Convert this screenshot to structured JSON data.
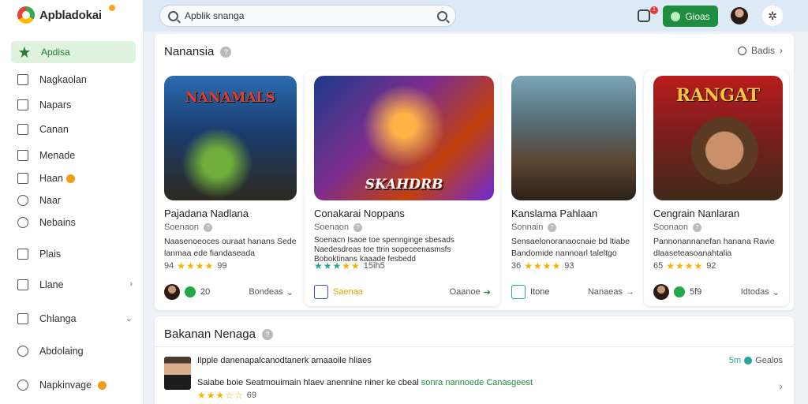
{
  "app": {
    "name": "Apbladokai"
  },
  "sidebar": {
    "active": {
      "label": "Apdisa",
      "icon": "star-icon"
    },
    "items": [
      {
        "label": "Nagkaolan",
        "icon": "list-icon"
      },
      {
        "label": "Napars",
        "icon": "document-icon"
      },
      {
        "label": "Canan",
        "icon": "message-icon"
      },
      {
        "label": "Menade",
        "icon": "mail-icon"
      },
      {
        "label": "Haan",
        "icon": "folder-icon"
      },
      {
        "label": "Naar",
        "icon": "music-icon"
      },
      {
        "label": "Nebains",
        "icon": "globe-icon"
      },
      {
        "label": "Plais",
        "icon": "grid-icon"
      },
      {
        "label": "Llane",
        "icon": "download-icon"
      },
      {
        "label": "Chlanga",
        "icon": "edit-icon"
      },
      {
        "label": "Abdolaing",
        "icon": "info-icon"
      },
      {
        "label": "Napkinvage",
        "icon": "settings-icon"
      }
    ]
  },
  "topbar": {
    "search_value": "Apblik snanga",
    "notification_count": "1",
    "action_label": "Gioas"
  },
  "section1": {
    "title": "Nanansia",
    "see_all": "Badis",
    "cards": [
      {
        "art_title": "NANAMALS",
        "title": "Pajadana Nadlana",
        "subtitle": "Soenaon",
        "desc": "Naasenoeoces ouraat hanans Sede lanmaa ede fiandaseada",
        "rating": "94",
        "rating_count": "99",
        "foot_value": "20",
        "foot_right": "Bondeas"
      },
      {
        "art_title": "SKAHDRB",
        "title": "Conakarai Noppans",
        "subtitle": "Soenaon",
        "desc": "Soenacn Isaoe toe spennginge sbesads Naedesdreas toe ttrin sopeceenasmsfs Boboktinans kaaade fesbedd",
        "rating": "",
        "rating_count": "15ih5",
        "extra_badge": "Saenaa",
        "foot_right": "Oaanoe"
      },
      {
        "art_title": "",
        "title": "Kanslama Pahlaan",
        "subtitle": "Sonnain",
        "desc": "Sensaelonoranaocnaie bd ltiabe Bandomide nannoarl taleltgo",
        "rating": "36",
        "rating_count": "93",
        "foot_value": "Itone",
        "foot_right": "Nanaeas"
      },
      {
        "art_title": "RANGAT",
        "title": "Cengrain Nanlaran",
        "subtitle": "Soonaon",
        "desc": "Pannonannanefan hanana Ravie dlaaseteasoanahtalia",
        "rating": "65",
        "rating_count": "92",
        "foot_value": "5f9",
        "foot_right": "Idtodas"
      }
    ]
  },
  "section2": {
    "title": "Bakanan Nenaga",
    "review": {
      "line1": "Ilpple danenapalcanodtanerk amaaoile hliaes",
      "right_value": "5m",
      "right_label": "Gealos",
      "line2_a": "Saiabe boie Seatmouimain hlaev anennine niner ke cbeal",
      "line2_b": "sonra nannoede",
      "line2_c": "Canasgeest",
      "rating": "69"
    }
  },
  "colors": {
    "accent": "#1e8e3e",
    "star": "#f5b400",
    "topbar": "#dde9f5",
    "active_bg": "#dff2dd"
  }
}
